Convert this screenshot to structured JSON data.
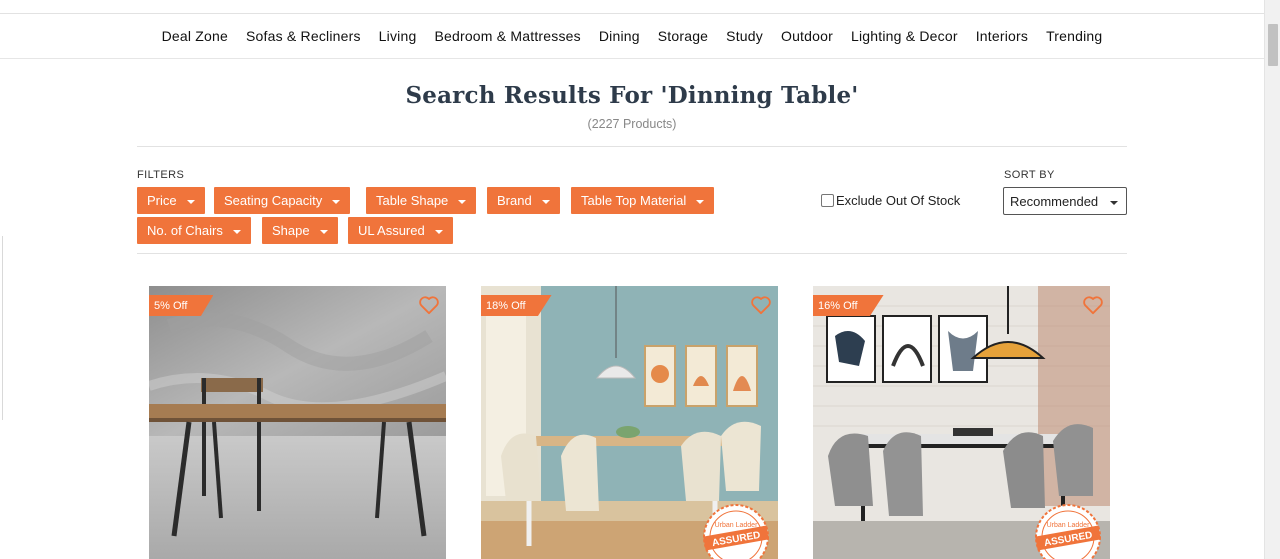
{
  "nav": {
    "items": [
      "Deal Zone",
      "Sofas & Recliners",
      "Living",
      "Bedroom & Mattresses",
      "Dining",
      "Storage",
      "Study",
      "Outdoor",
      "Lighting & Decor",
      "Interiors",
      "Trending"
    ]
  },
  "search": {
    "title": "Search Results For 'Dinning Table'",
    "count": "(2227 Products)"
  },
  "filters": {
    "label": "FILTERS",
    "chips": [
      "Price",
      "Seating Capacity",
      "Table Shape",
      "Brand",
      "Table Top Material",
      "No. of Chairs",
      "Shape",
      "UL Assured"
    ],
    "exclude_out_of_stock": "Exclude Out Of Stock",
    "exclude_checked": false
  },
  "sort": {
    "label": "SORT BY",
    "selected": "Recommended"
  },
  "products": [
    {
      "badge": "5% Off",
      "assured": false
    },
    {
      "badge": "18% Off",
      "assured": true
    },
    {
      "badge": "16% Off",
      "assured": true
    }
  ],
  "assured_badge": {
    "line1": "Urban Ladder",
    "line2": "ASSURED"
  },
  "colors": {
    "accent": "#f0743b",
    "title": "#2e3b4a",
    "text": "#222222"
  }
}
